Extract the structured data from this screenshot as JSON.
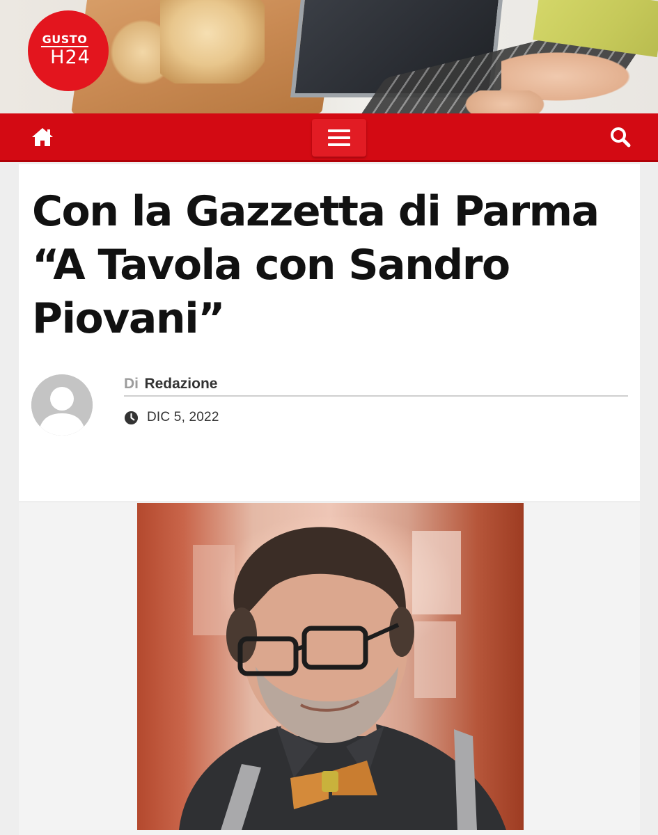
{
  "brand": {
    "line1": "GUSTO",
    "line2": "H24",
    "color": "#e3151e"
  },
  "nav": {
    "background": "#d30a13",
    "home_icon": "home-icon",
    "menu_icon": "hamburger-menu-icon",
    "search_icon": "search-icon"
  },
  "article": {
    "title": "Con la Gazzetta di Parma “A Tavola con Sandro Piovani”",
    "byline_prefix": "Di",
    "author": "Redazione",
    "date": "DIC 5, 2022",
    "avatar_icon": "default-user-avatar",
    "date_icon": "clock-icon"
  }
}
